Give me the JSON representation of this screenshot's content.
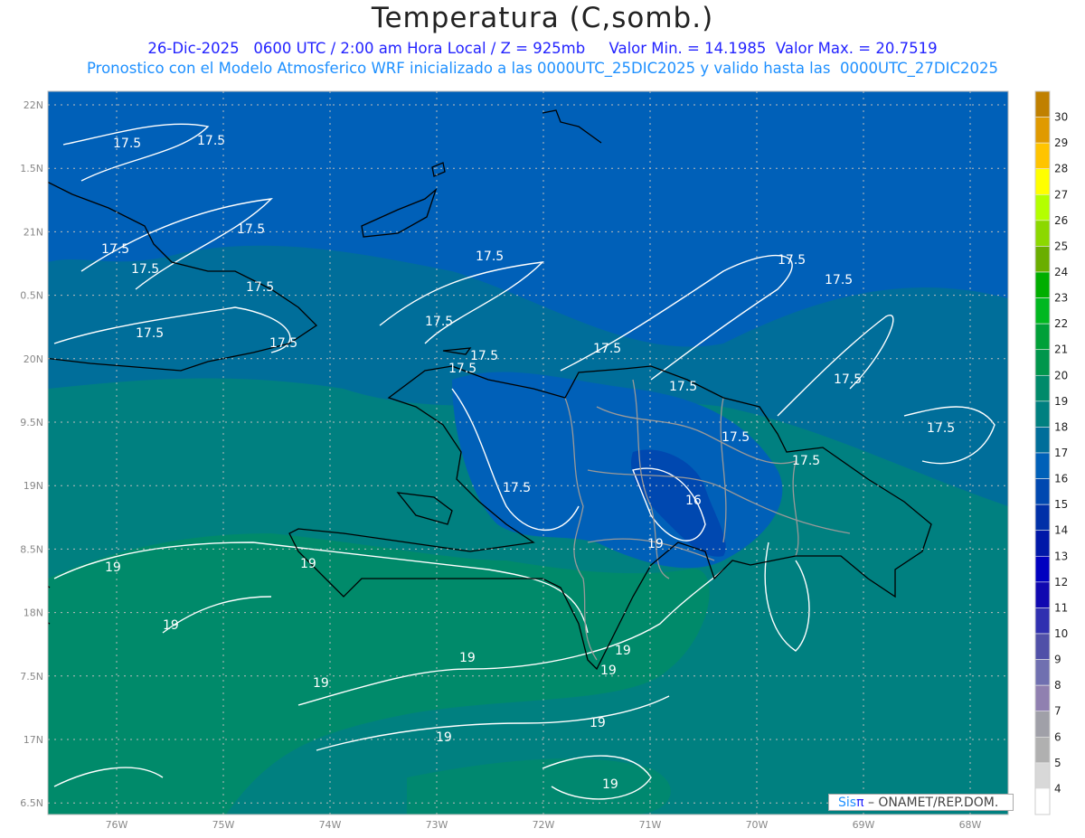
{
  "header": {
    "title": "Temperatura (C,somb.)",
    "line1": "26-Dic-2025   0600 UTC / 2:00 am Hora Local / Z = 925mb     Valor Min. = 14.1985  Valor Max. = 20.7519",
    "line2": "Pronostico con el Modelo Atmosferico WRF inicializado a las 0000UTC_25DIC2025 y valido hasta las  0000UTC_27DIC2025"
  },
  "map": {
    "lon_labels": [
      "76W",
      "75W",
      "74W",
      "73W",
      "72W",
      "71W",
      "70W",
      "69W",
      "68W"
    ],
    "lat_labels": [
      "22N",
      "1.5N",
      "21N",
      "0.5N",
      "20N",
      "9.5N",
      "19N",
      "8.5N",
      "18N",
      "7.5N",
      "17N",
      "6.5N"
    ],
    "contour_labels": [
      "17.5",
      "17.5",
      "17.5",
      "17.5",
      "17.5",
      "17.5",
      "17.5",
      "17.5",
      "17.5",
      "17.5",
      "17.5",
      "17.5",
      "17.5",
      "17.5",
      "17.5",
      "17.5",
      "17.5",
      "17.5",
      "17.5",
      "17.5",
      "17.5",
      "16",
      "19",
      "19",
      "19",
      "19",
      "19",
      "19",
      "19",
      "19",
      "19",
      "19",
      "19"
    ],
    "field_colors": {
      "blue_deep": "#0048b0",
      "blue": "#0060b8",
      "blue_teal": "#006e9a",
      "teal": "#008080",
      "green_teal": "#008a6a"
    }
  },
  "colorbar": {
    "labels": [
      "30",
      "29",
      "28",
      "27",
      "26",
      "25",
      "24",
      "23",
      "22",
      "21",
      "20",
      "19",
      "18",
      "17",
      "16",
      "15",
      "14",
      "13",
      "12",
      "11",
      "10",
      "9",
      "8",
      "7",
      "6",
      "5",
      "4"
    ],
    "colors": [
      "#c08000",
      "#e09a00",
      "#ffc400",
      "#ffff00",
      "#b4ff00",
      "#8cd800",
      "#6aae00",
      "#00ae00",
      "#00b820",
      "#00a038",
      "#00964c",
      "#008a6a",
      "#008080",
      "#006e9a",
      "#0060b8",
      "#0048b0",
      "#0030a8",
      "#0018a8",
      "#0000c0",
      "#1008b0",
      "#3030b0",
      "#5050a8",
      "#7070b0",
      "#9080b0",
      "#a0a0a8",
      "#b0b0b0",
      "#d8d8d8",
      "#ffffff"
    ]
  },
  "credit": {
    "sis": "Sis",
    "pi": "π",
    "rest": " – ONAMET/REP.DOM."
  }
}
